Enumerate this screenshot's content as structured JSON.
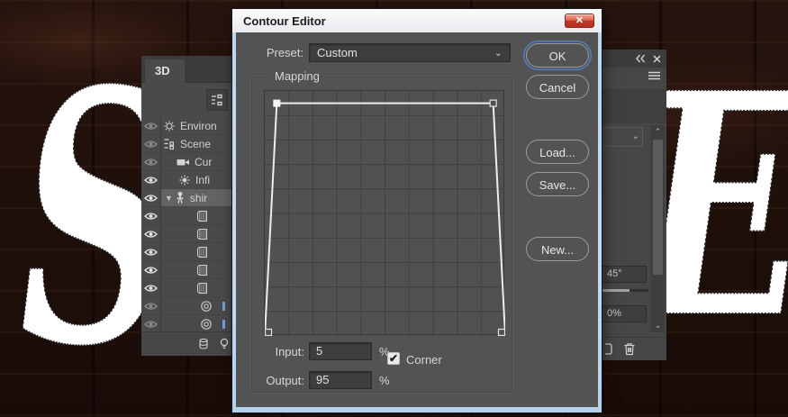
{
  "background": {
    "letters": [
      "S",
      "E"
    ]
  },
  "panel_3d": {
    "tab": "3D",
    "rows": [
      {
        "icon": "environment",
        "label": "Environ",
        "eye": "dim",
        "indent": 2
      },
      {
        "icon": "scene",
        "label": "Scene",
        "eye": "dim",
        "indent": 2
      },
      {
        "icon": "camera",
        "label": "Cur",
        "eye": "dim",
        "indent": 17
      },
      {
        "icon": "light",
        "label": "Infi",
        "eye": "bright",
        "indent": 19
      },
      {
        "icon": "mesh",
        "label": "shir",
        "eye": "bright",
        "indent": 4,
        "expanded": true,
        "selected": true
      },
      {
        "icon": "texture",
        "label": "",
        "eye": "bright",
        "indent": 39
      },
      {
        "icon": "texture",
        "label": "",
        "eye": "bright",
        "indent": 39
      },
      {
        "icon": "texture",
        "label": "",
        "eye": "bright",
        "indent": 39
      },
      {
        "icon": "texture",
        "label": "",
        "eye": "bright",
        "indent": 39
      },
      {
        "icon": "texture",
        "label": "",
        "eye": "bright",
        "indent": 39
      },
      {
        "icon": "sphere",
        "label": "",
        "eye": "dim",
        "indent": 43,
        "frag": true
      },
      {
        "icon": "sphere",
        "label": "",
        "eye": "dim",
        "indent": 43,
        "frag": true
      }
    ]
  },
  "properties_panel": {
    "angle_value": "45°",
    "strength_value": "0%"
  },
  "dialog": {
    "title": "Contour Editor",
    "preset_label": "Preset:",
    "preset_value": "Custom",
    "group_label": "Mapping",
    "buttons": {
      "ok": "OK",
      "cancel": "Cancel",
      "load": "Load...",
      "save": "Save...",
      "new": "New..."
    },
    "input_label": "Input:",
    "input_value": "5",
    "input_unit": "%",
    "output_label": "Output:",
    "output_value": "95",
    "output_unit": "%",
    "corner_label": "Corner",
    "corner_checked": true,
    "curve": {
      "grid_divisions": 10,
      "points": [
        [
          0,
          0
        ],
        [
          5,
          95
        ],
        [
          95,
          95
        ],
        [
          100,
          0
        ]
      ],
      "selected_index": 1
    }
  },
  "colors": {
    "accent_blue": "#4c7fc6",
    "close_red": "#c23a24",
    "frame_blue": "#bcd7ee",
    "panel_gray": "#4a4a4a",
    "dialog_gray": "#535353",
    "curve_white": "#ededed"
  }
}
